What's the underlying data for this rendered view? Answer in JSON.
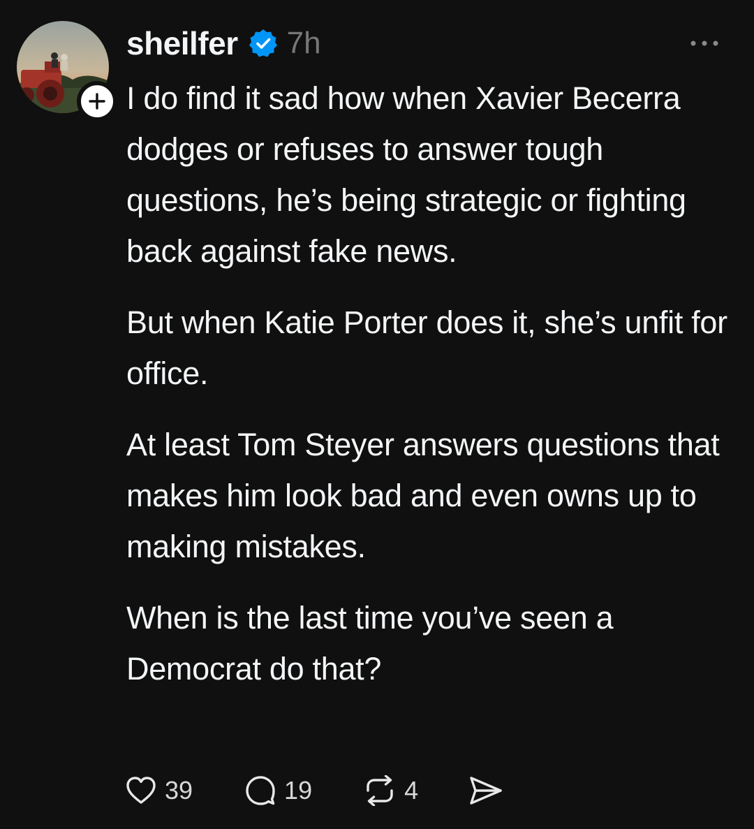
{
  "post": {
    "username": "sheilfer",
    "verified": true,
    "timestamp": "7h",
    "paragraphs": [
      "I do find it sad how when Xavier Becerra dodges or refuses to answer tough questions, he’s being strategic or fighting back against fake news.",
      "But when Katie Porter does it, she’s unfit for office.",
      "At least Tom Steyer answers questions that makes him look bad and even owns up to making mistakes.",
      "When is the last time you’ve seen a Democrat do that?"
    ],
    "actions": {
      "likes": "39",
      "replies": "19",
      "reposts": "4"
    }
  },
  "icons": {
    "more": "more-options-icon",
    "follow": "plus-icon",
    "verified": "verified-badge-icon",
    "like": "heart-icon",
    "reply": "comment-icon",
    "repost": "repost-icon",
    "share": "send-icon"
  },
  "colors": {
    "background": "#101010",
    "text": "#f3f5f7",
    "muted": "#777777",
    "verified": "#0095f6"
  }
}
